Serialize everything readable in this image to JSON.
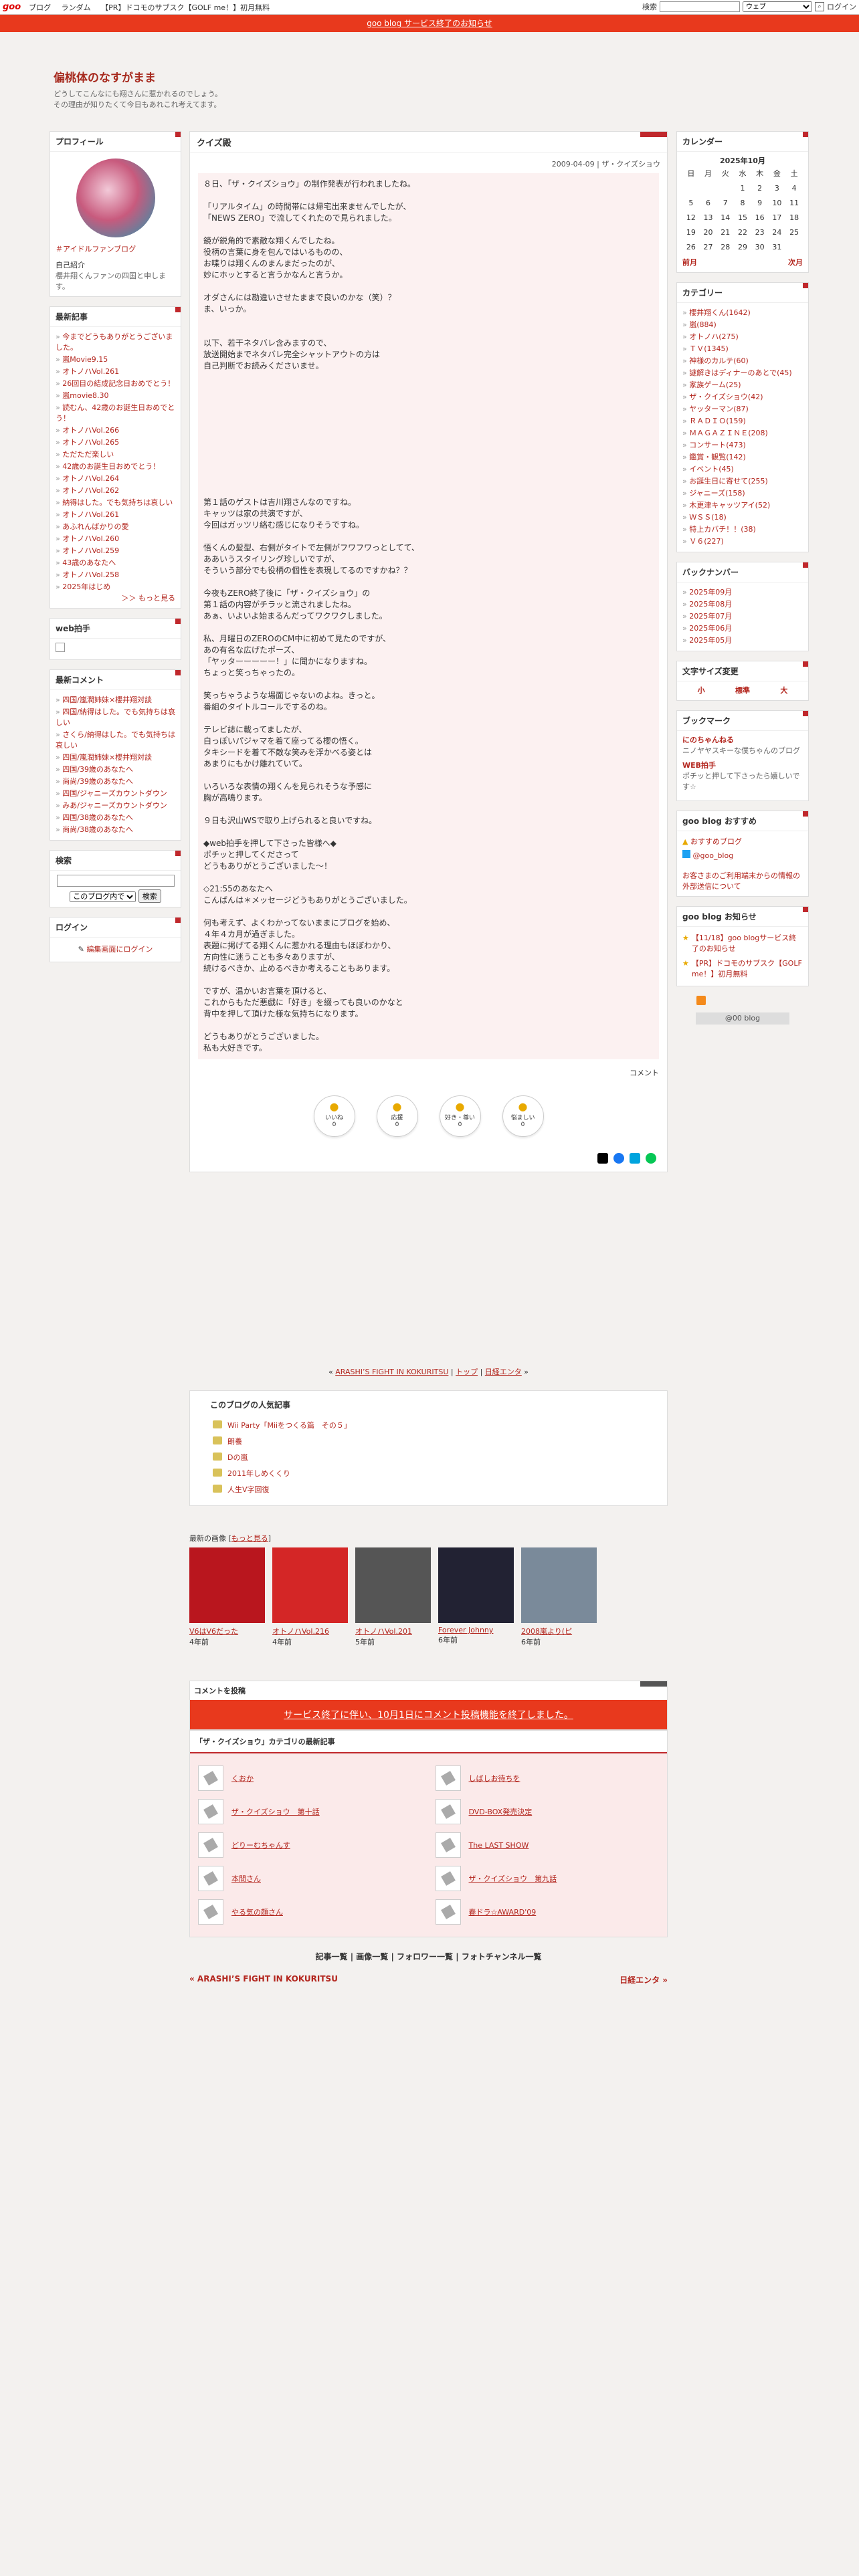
{
  "topbar": {
    "logo": "goo",
    "nav": [
      "ブログ",
      "ランダム",
      "【PR】ドコモのサブスク【GOLF me！】初月無料"
    ],
    "search_label": "検索",
    "search_placeholder": "",
    "select_value": "ウェブ",
    "login": "ログイン"
  },
  "notice": "goo blog サービス終了のお知らせ",
  "blog": {
    "title": "偏桃体のなすがまま",
    "desc1": "どうしてこんなにも翔さんに惹かれるのでしょう。",
    "desc2": "その理由が知りたくて今日もあれこれ考えてます。"
  },
  "profile": {
    "heading": "プロフィール",
    "tag": "＃アイドルファンブログ",
    "self_label": "自己紹介",
    "self_text": "櫻井翔くんファンの四国と申します。"
  },
  "recent": {
    "heading": "最新記事",
    "items": [
      "今までどうもありがとうございました。",
      "嵐Movie9.15",
      "オトノハVol.261",
      "26回目の結成記念日おめでとう！",
      "嵐movie8.30",
      "読むん、42歳のお誕生日おめでとう！",
      "オトノハVol.266",
      "オトノハVol.265",
      "ただただ楽しい",
      "42歳のお誕生日おめでとう！",
      "オトノハVol.264",
      "オトノハVol.262",
      "納得はした。でも気持ちは哀しい",
      "オトノハVol.261",
      "あふれんばかりの愛",
      "オトノハVol.260",
      "オトノハVol.259",
      "43歳のあなたへ",
      "オトノハVol.258",
      "2025年はじめ"
    ],
    "more": "＞＞ もっと見る"
  },
  "web_clap": {
    "heading": "web拍手"
  },
  "comments": {
    "heading": "最新コメント",
    "items": [
      "四国/嵐潤姉妹×櫻井翔対談",
      "四国/納得はした。でも気持ちは哀しい",
      "さくら/納得はした。でも気持ちは哀しい",
      "四国/嵐潤姉妹×櫻井翔対談",
      "四国/39歳のあなたへ",
      "尚尚/39歳のあなたへ",
      "四国/ジャニーズカウントダウン",
      "みあ/ジャニーズカウントダウン",
      "四国/38歳のあなたへ",
      "尚尚/38歳のあなたへ"
    ]
  },
  "search": {
    "heading": "検索",
    "select": "このブログ内で",
    "btn": "検索"
  },
  "login": {
    "heading": "ログイン",
    "link": "編集画面にログイン"
  },
  "article": {
    "title": "クイズ殿",
    "date": "2009-04-09 | ザ・クイズショウ",
    "body": "８日、「ザ・クイズショウ」の制作発表が行われましたね。\n\n「リアルタイム」の時間帯には帰宅出来ませんでしたが、\n「NEWS ZERO」で流してくれたので見られました。\n\n鏡が鋭角的で素敵な翔くんでしたね。\n役柄の言葉に身を包んではいるものの、\nお喋りは翔くんのまんまだったのが、\n妙にホッとすると言うかなんと言うか。\n\nオダさんには勘違いさせたままで良いのかな（笑）？\nま、いっか。\n\n\n以下、若干ネタバレ含みますので、\n放送開始までネタバレ完全シャットアウトの方は\n自己判断でお読みくださいませ。\n\n\n\n\n\n\n\n\n\n\n\n第１話のゲストは吉川翔さんなのですね。\nキャッツは家の共演ですが、\n今回はガッツリ絡む感じになりそうですね。\n\n悟くんの髪型、右側がタイトで左側がフワフワっとしてて、\nああいうスタイリング珍しいですが、\nそういう部分でも役柄の個性を表現してるのですかね？？\n\n今夜もZERO終了後に「ザ・クイズショウ」の\n第１話の内容がチラッと流されましたね。\nあぁ、いよいよ始まるんだってワクワクしました。\n\n私、月曜日のZEROのCM中に初めて見たのですが、\nあの有名な広げたポーズ、\n「ヤッターーーーー！」に聞かになりますね。\nちょっと笑っちゃったの。\n\n笑っちゃうような場面じゃないのよね。きっと。\n番組のタイトルコールでするのね。\n\nテレビ誌に載ってましたが、\n白っぽいパジャマを着て座ってる櫻の悟く。\nタキシードを着て不敵な笑みを浮かべる姿とは\nあまりにもかけ離れていて。\n\nいろいろな表情の翔くんを見られそうな予感に\n胸が高鳴ります。\n\n９日も沢山WSで取り上げられると良いですね。\n\n◆web拍手を押して下さった皆様へ◆\nポチッと押してくださって\nどうもありがとうございました〜！\n\n◇21:55のあなたへ\nこんばんは＊メッセージどうもありがとうございました。\n\n何も考えず、よくわかってないままにブログを始め、\n４年４カ月が過ぎました。\n表題に掲げてる翔くんに惹かれる理由もほぼわかり、\n方向性に迷うことも多々ありますが、\n続けるべきか、止めるべきか考えることもあります。\n\nですが、温かいお言葉を頂けると、\nこれからもただ悪戯に「好き」を綴っても良いのかなと\n背中を押して頂けた様な気持ちになります。\n\nどうもありがとうございました。\n私も大好きです。",
    "comment_link": "コメント",
    "reactions": [
      {
        "label": "いいね",
        "count": "0",
        "icon": "thumbs-up"
      },
      {
        "label": "応援",
        "count": "0",
        "icon": "megaphone"
      },
      {
        "label": "好き・尊い",
        "count": "0",
        "icon": "heart-eyes"
      },
      {
        "label": "悩ましい",
        "count": "0",
        "icon": "clap"
      }
    ]
  },
  "pager": {
    "prev": "ARASHI’S FIGHT IN KOKURITSU",
    "top": "トップ",
    "next": "日経エンタ"
  },
  "popular": {
    "heading": "このブログの人気記事",
    "items": [
      "Wii Party「Miiをつくる篇　その５」",
      "朗養",
      "Dの嵐",
      "2011年しめくくり",
      "人生V字回復"
    ]
  },
  "images": {
    "heading": "最新の画像",
    "more": "もっと見る",
    "items": [
      {
        "title": "V6はV6だった",
        "ago": "4年前",
        "color": "#b9161e"
      },
      {
        "title": "オトノハVol.216",
        "ago": "4年前",
        "color": "#d42626"
      },
      {
        "title": "オトノハVol.201",
        "ago": "5年前",
        "color": "#555"
      },
      {
        "title": "Forever Johnny",
        "ago": "6年前",
        "color": "#223"
      },
      {
        "title": "2008嵐より(ピ",
        "ago": "6年前",
        "color": "#7a8a9a"
      }
    ]
  },
  "comment_post": {
    "heading": "コメントを投稿",
    "banner": "サービス終了に伴い、10月1日にコメント投稿機能を終了しました。"
  },
  "cat_latest": {
    "heading": "「ザ・クイズショウ」カテゴリの最新記事",
    "items": [
      "くおか",
      "しばしお待ちを",
      "ザ・クイズショウ　第十話",
      "DVD-BOX発売決定",
      "どりーむちゃんす",
      "The LAST SHOW",
      "本間さん",
      "ザ・クイズショウ　第九話",
      "やる気の顔さん",
      "春ドラ☆AWARD'09"
    ]
  },
  "foot_links": [
    "記事一覧",
    "画像一覧",
    "フォロワー一覧",
    "フォトチャンネル一覧"
  ],
  "nav2": {
    "prev": "« ARASHI’S FIGHT IN KOKURITSU",
    "next": "日経エンタ »"
  },
  "calendar": {
    "heading": "カレンダー",
    "month": "2025年10月",
    "week": [
      "日",
      "月",
      "火",
      "水",
      "木",
      "金",
      "土"
    ],
    "rows": [
      [
        "",
        "",
        "",
        "1",
        "2",
        "3",
        "4"
      ],
      [
        "5",
        "6",
        "7",
        "8",
        "9",
        "10",
        "11"
      ],
      [
        "12",
        "13",
        "14",
        "15",
        "16",
        "17",
        "18"
      ],
      [
        "19",
        "20",
        "21",
        "22",
        "23",
        "24",
        "25"
      ],
      [
        "26",
        "27",
        "28",
        "29",
        "30",
        "31",
        ""
      ]
    ],
    "prev": "前月",
    "next": "次月"
  },
  "category": {
    "heading": "カテゴリー",
    "items": [
      "櫻井翔くん(1642)",
      "嵐(884)",
      "オトノハ(275)",
      "ＴＶ(1345)",
      "神様のカルテ(60)",
      "謎解きはディナーのあとで(45)",
      "家族ゲーム(25)",
      "ザ・クイズショウ(42)",
      "ヤッターマン(87)",
      "ＲＡＤＩＯ(159)",
      "ＭＡＧＡＺＩＮＥ(208)",
      "コンサート(473)",
      "鑑賞・観覧(142)",
      "イベント(45)",
      "お誕生日に寄せて(255)",
      "ジャニーズ(158)",
      "木更津キャッツアイ(52)",
      "ＷＳＳ(18)",
      "特上カバチ！！(38)",
      "Ｖ６(227)"
    ]
  },
  "backnumber": {
    "heading": "バックナンバー",
    "items": [
      "2025年09月",
      "2025年08月",
      "2025年07月",
      "2025年06月",
      "2025年05月"
    ]
  },
  "fontsize": {
    "heading": "文字サイズ変更",
    "small": "小",
    "std": "標準",
    "large": "大"
  },
  "bookmark": {
    "heading": "ブックマーク",
    "items": [
      {
        "title": "にのちゃんねる",
        "desc": "ニノヤヤスキーな僕ちゃんのブログ"
      },
      {
        "title": "WEB拍手",
        "desc": "ポチッと押して下さったら嬉しいです☆"
      }
    ]
  },
  "goo_rec": {
    "heading": "goo blog おすすめ",
    "items": [
      "おすすめブログ",
      "@goo_blog"
    ],
    "note": "お客さまのご利用端末からの情報の外部送信について"
  },
  "goo_news": {
    "heading": "goo blog お知らせ",
    "items": [
      "【11/18】goo blogサービス終了のお知らせ",
      "【PR】ドコモのサブスク【GOLF me！】初月無料"
    ]
  },
  "goo_badge": "@00 blog"
}
